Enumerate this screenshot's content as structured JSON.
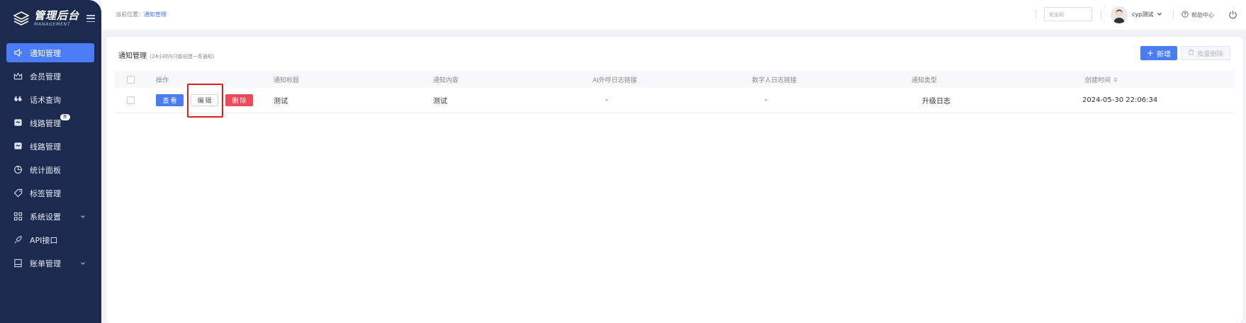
{
  "sidebar": {
    "logo_title": "管理后台",
    "logo_sub": "MANAGEMENT",
    "items": [
      {
        "label": "通知管理",
        "icon": "speaker-icon",
        "active": true
      },
      {
        "label": "会员管理",
        "icon": "crown-icon"
      },
      {
        "label": "话术查询",
        "icon": "quote-icon"
      },
      {
        "label": "线路管理",
        "icon": "route-icon",
        "badge": "新"
      },
      {
        "label": "线路管理",
        "icon": "route-icon"
      },
      {
        "label": "统计面板",
        "icon": "pie-chart-icon"
      },
      {
        "label": "标签管理",
        "icon": "tag-icon"
      },
      {
        "label": "系统设置",
        "icon": "grid-icon",
        "expandable": true
      },
      {
        "label": "API接口",
        "icon": "rocket-icon"
      },
      {
        "label": "账单管理",
        "icon": "bill-icon",
        "expandable": true
      }
    ]
  },
  "header": {
    "breadcrumb_prefix": "当前位置：",
    "breadcrumb_current": "通知管理",
    "search_placeholder": "安全码",
    "username": "cyp测试",
    "help": "帮助中心"
  },
  "page": {
    "title": "通知管理",
    "note": "（24小时内只能创建一条通知）",
    "new_button": "新增",
    "batch_delete_button": "批量删除"
  },
  "table": {
    "columns": [
      "操作",
      "通知标题",
      "通知内容",
      "AI外呼日志链接",
      "数字人日志链接",
      "通知类型",
      "创建时间"
    ],
    "actions": {
      "view": "查看",
      "edit": "编辑",
      "delete": "删除"
    },
    "rows": [
      {
        "title": "测试",
        "content": "测试",
        "ai_link": "-",
        "digital_link": "-",
        "type": "升级日志",
        "created": "2024-05-30 22:06:34"
      }
    ]
  },
  "colors": {
    "sidebar": "#1b2a4e",
    "accent": "#4a7cf6",
    "danger": "#f0485a",
    "highlight": "#e21b1b"
  }
}
